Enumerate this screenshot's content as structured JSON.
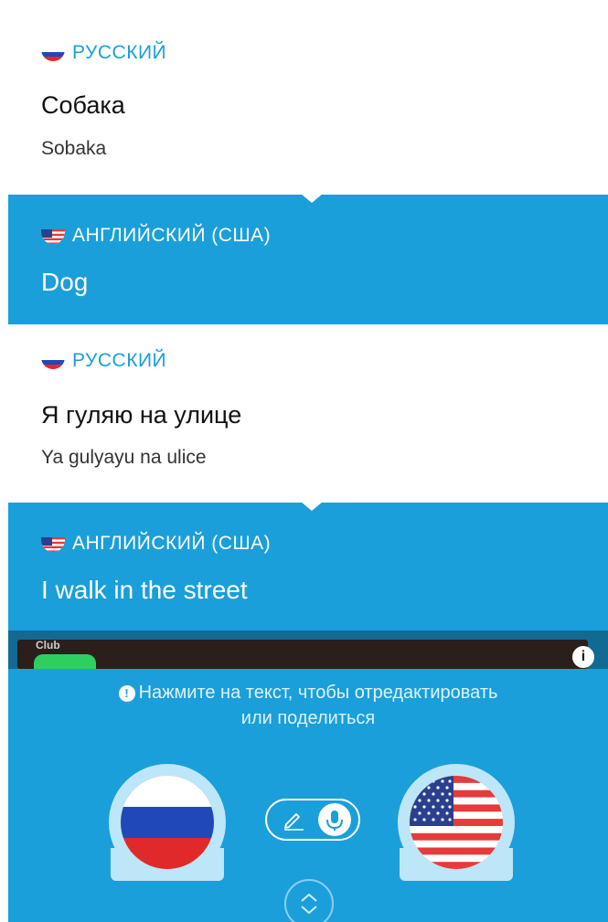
{
  "entries": [
    {
      "source": {
        "language": "РУССКИЙ",
        "text": "Собака",
        "transliteration": "Sobaka"
      },
      "target": {
        "language": "АНГЛИЙСКИЙ (США)",
        "text": "Dog"
      }
    },
    {
      "source": {
        "language": "РУССКИЙ",
        "text": "Я гуляю на улице",
        "transliteration": "Ya gulyayu na ulice"
      },
      "target": {
        "language": "АНГЛИЙСКИЙ (США)",
        "text": "I walk in the street"
      }
    }
  ],
  "ad": {
    "brand": "Club"
  },
  "hint": {
    "line1": "Нажмите на текст, чтобы отредактировать",
    "line2": "или поделиться"
  },
  "controls": {
    "left_language_icon": "russia-flag-icon",
    "right_language_icon": "usa-flag-icon",
    "mode_icons": [
      "pencil-icon",
      "microphone-icon"
    ],
    "expand_icon": "chevron-up-down-icon"
  },
  "colors": {
    "accent": "#1a9fda",
    "ad_strip": "#106a92",
    "bubble": "#bde6f8"
  }
}
